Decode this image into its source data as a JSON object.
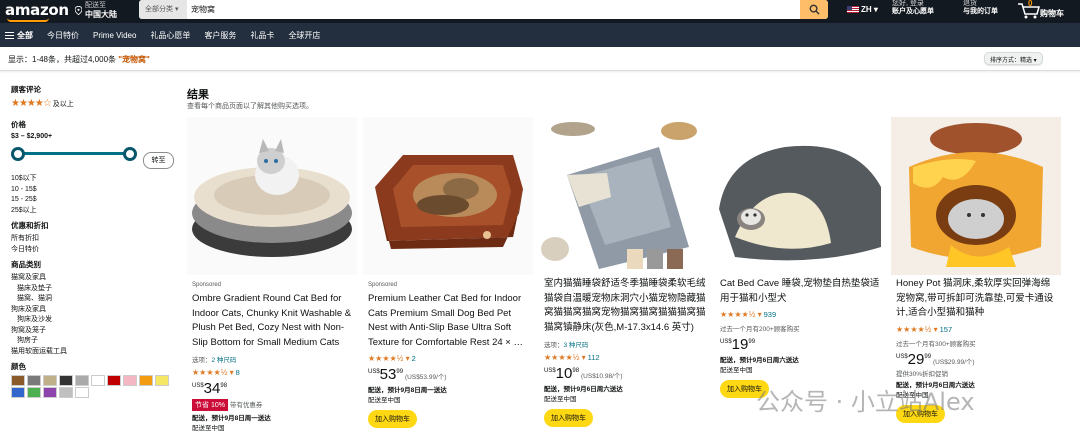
{
  "header": {
    "logo": "amazon",
    "deliver_line1": "配送至",
    "deliver_line2": "中国大陆",
    "search_category": "全部分类",
    "search_value": "宠物窝",
    "language": "ZH",
    "account_line1": "您好, 登录",
    "account_line2": "账户及心愿单",
    "orders_line1": "退货",
    "orders_line2": "与我的订单",
    "cart_count": "0",
    "cart_label": "购物车"
  },
  "navbar": {
    "all": "全部",
    "items": [
      "今日特价",
      "Prime Video",
      "礼品心愿单",
      "客户服务",
      "礼品卡",
      "全球开店"
    ]
  },
  "results_bar": {
    "prefix": "显示：1-48条，共超过4,000条",
    "keyword": "\"宠物窝\"",
    "sort": "排序方式：精选"
  },
  "sidebar": {
    "review_heading": "顾客评论",
    "review_stars": "★★★★☆",
    "review_suffix": "及以上",
    "price_heading": "价格",
    "price_range": "$3 – $2,900+",
    "go_button": "转至",
    "price_options": [
      "10$以下",
      "10 - 15$",
      "15 - 25$",
      "25$以上"
    ],
    "deals_heading": "优惠和折扣",
    "deals": [
      "所有折扣",
      "今日特价"
    ],
    "category_heading": "商品类别",
    "categories": [
      {
        "label": "猫窝及家具",
        "indent": false
      },
      {
        "label": "猫床及垫子",
        "indent": true
      },
      {
        "label": "猫窝、猫洞",
        "indent": true
      },
      {
        "label": "狗床及家具",
        "indent": false
      },
      {
        "label": "狗床及沙发",
        "indent": true
      },
      {
        "label": "狗窝及笼子",
        "indent": false
      },
      {
        "label": "狗房子",
        "indent": true
      },
      {
        "label": "猫用软面运载工具",
        "indent": false
      }
    ],
    "color_heading": "颜色",
    "colors": [
      "#8b5a2b",
      "#7a7a7a",
      "#bfb08a",
      "#333333",
      "#aaaaaa",
      "#ffffff",
      "#c00000",
      "#f4b6c2",
      "#f39c12",
      "#f5e663",
      "#3366cc",
      "#4caf50",
      "#8e44ad",
      "#c0c0c0",
      "#ffffff"
    ]
  },
  "results": {
    "title": "结果",
    "subtitle": "查看每个商品页面以了解其他购买选项。"
  },
  "products": [
    {
      "sponsored": "Sponsored",
      "title": "Ombre Gradient Round Cat Bed for Indoor Cats, Chunky Knit Washable & Plush Pet Bed, Cozy Nest with Non-Slip Bottom for Small Medium Cats",
      "stars": "★★★★½",
      "reviews": "8",
      "options": "选项：",
      "options_link": "2 种尺码",
      "currency": "US$",
      "price_whole": "34",
      "price_fraction": "98",
      "unit_price": "",
      "deal": "节省 10%",
      "deal_note": "带有优惠券",
      "delivery": "配送，预计9月8日周一送达",
      "ship_to": "配送至中国",
      "cart": ""
    },
    {
      "sponsored": "Sponsored",
      "title": "Premium Leather Cat Bed for Indoor Cats Premium Small Dog Bed Pet Nest with Anti-Slip Base Ultra Soft Texture for Comfortable Rest 24 × …",
      "stars": "★★★★½",
      "reviews": "2",
      "options": "",
      "options_link": "",
      "currency": "US$",
      "price_whole": "53",
      "price_fraction": "99",
      "unit_price": "(US$53.99/个)",
      "deal": "",
      "deal_note": "",
      "delivery": "配送，预计9月8日周一送达",
      "ship_to": "配送至中国",
      "cart": "加入购物车"
    },
    {
      "sponsored": "",
      "title": "室内猫猫睡袋舒适冬季猫睡袋柔软毛绒猫袋自温暖宠物床洞穴小猫宠物隐藏猫窝猫猫窝猫窝宠物猫窝猫窝猫猫猫窝猫猫窝镇静床(灰色,M-17.3x14.6 英寸)",
      "stars": "★★★★½",
      "reviews": "112",
      "options": "选项：",
      "options_link": "3 种尺码",
      "currency": "US$",
      "price_whole": "10",
      "price_fraction": "98",
      "unit_price": "(US$10.98/个)",
      "deal": "",
      "deal_note": "",
      "delivery": "配送，预计9月6日周六送达",
      "ship_to": "配送至中国",
      "cart": "加入购物车"
    },
    {
      "sponsored": "",
      "title": "Cat Bed Cave 睡袋,宠物垫自热垫袋适用于猫和小型犬",
      "stars": "★★★★½",
      "reviews": "939",
      "options": "过去一个月有200+顾客购买",
      "options_link": "",
      "currency": "US$",
      "price_whole": "19",
      "price_fraction": "99",
      "unit_price": "",
      "deal": "",
      "deal_note": "",
      "delivery": "配送，预计9月6日周六送达",
      "ship_to": "配送至中国",
      "cart": "加入购物车"
    },
    {
      "sponsored": "",
      "title": "Honey Pot 猫洞床,柔软厚实回弹海绵宠物窝,带可拆卸可洗靠垫,可爱卡通设计,适合小型猫和猫种",
      "stars": "★★★★½",
      "reviews": "157",
      "options": "过去一个月有300+顾客购买",
      "options_link": "",
      "currency": "US$",
      "price_whole": "29",
      "price_fraction": "99",
      "unit_price": "(US$29.99/个)",
      "deal": "",
      "deal_note": "提供30%折扣促销",
      "delivery": "配送，预计9月6日周六送达",
      "ship_to": "配送至中国",
      "cart": "加入购物车"
    }
  ],
  "watermark": "公众号 · 小立站Alex"
}
